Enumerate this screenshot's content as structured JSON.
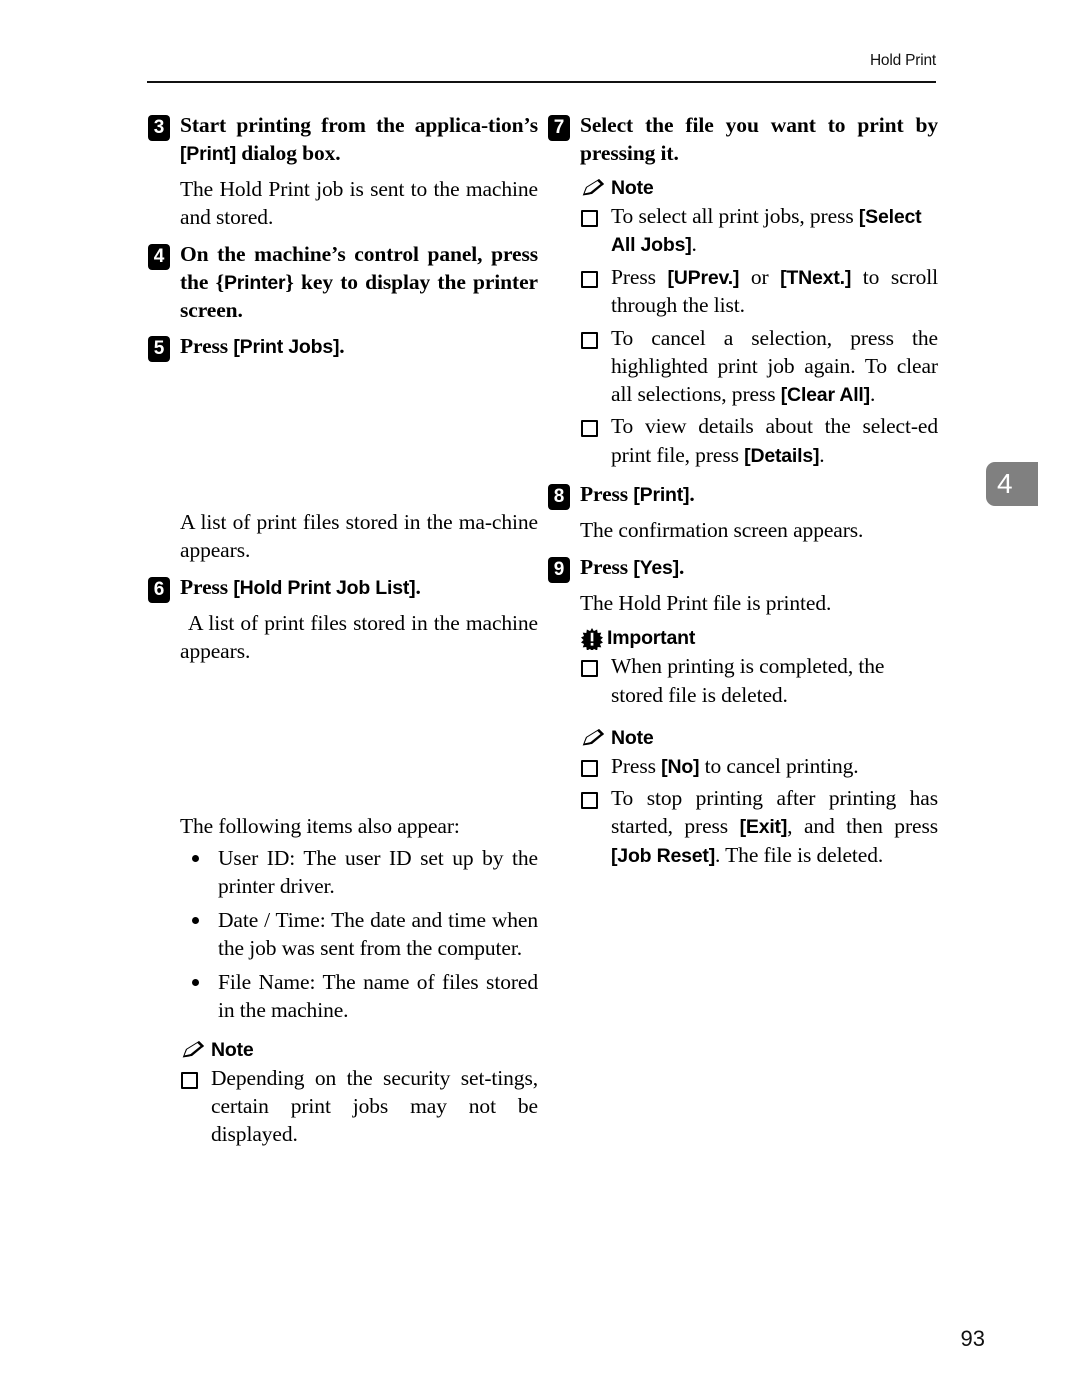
{
  "header": {
    "title": "Hold Print"
  },
  "chapter_tab": {
    "number": "4"
  },
  "folio": {
    "page_number": "93"
  },
  "left_column": {
    "step3": {
      "num": "3",
      "text_a": "Start printing from the applica-tion’s ",
      "key": "[Print]",
      "text_b": " dialog box.",
      "body": "The Hold Print job is sent to the machine and stored."
    },
    "step4": {
      "num": "4",
      "text_a": "On the machine’s control panel, press the {",
      "key": "Printer",
      "text_b": "} key to display the printer screen."
    },
    "step5": {
      "num": "5",
      "text_a": "Press ",
      "key": "[Print Jobs]",
      "text_b": ".",
      "body": "A list of print files stored in the ma-chine appears."
    },
    "step6": {
      "num": "6",
      "text_a": "Press ",
      "key": "[Hold Print Job List]",
      "text_b": ".",
      "body": "A list of print files stored in the machine appears."
    },
    "following_items_lead": "The following items also appear:",
    "bullets": [
      "User ID: The user ID set up by the printer driver.",
      "Date / Time: The date and time when the job was sent from the computer.",
      "File Name: The name of files stored in the machine."
    ],
    "note": {
      "label": "Note",
      "icon": "pencil-icon",
      "items": [
        "Depending on the security set-tings, certain print jobs may not be displayed."
      ]
    }
  },
  "right_column": {
    "step7": {
      "num": "7",
      "text": "Select the file you want to print by pressing it.",
      "note": {
        "label": "Note",
        "icon": "pencil-icon",
        "items": [
          {
            "text_a": "To select all print jobs, press ",
            "key": "[Select All Jobs]",
            "text_b": "."
          },
          {
            "text_a": "Press ",
            "key1": "[UPrev.]",
            "text_mid": " or ",
            "key2": "[TNext.]",
            "text_b": " to scroll through the list."
          },
          {
            "text_a": "To cancel a selection, press the highlighted print job again. To clear all selections, press ",
            "key": "[Clear All]",
            "text_b": "."
          },
          {
            "text_a": "To view details about the select-ed print file, press ",
            "key": "[Details]",
            "text_b": "."
          }
        ]
      }
    },
    "step8": {
      "num": "8",
      "text_a": "Press ",
      "key": "[Print]",
      "text_b": ".",
      "body": "The confirmation screen appears."
    },
    "step9": {
      "num": "9",
      "text_a": "Press ",
      "key": "[Yes]",
      "text_b": ".",
      "body": "The Hold Print file is printed.",
      "important": {
        "label": "Important",
        "icon": "exclamation-burst-icon",
        "items": [
          "When printing is completed, the stored file is deleted."
        ]
      },
      "note": {
        "label": "Note",
        "icon": "pencil-icon",
        "items": [
          {
            "text_a": "Press ",
            "key": "[No]",
            "text_b": " to cancel printing."
          },
          {
            "text_a": "To stop printing after printing has started, press ",
            "key1": "[Exit]",
            "text_mid": ", and then press ",
            "key2": "[Job Reset]",
            "text_b": ". The file is deleted."
          }
        ]
      }
    }
  },
  "colors": {
    "ink": "#000000",
    "paper": "#ffffff",
    "tab_gray": "#808080"
  }
}
